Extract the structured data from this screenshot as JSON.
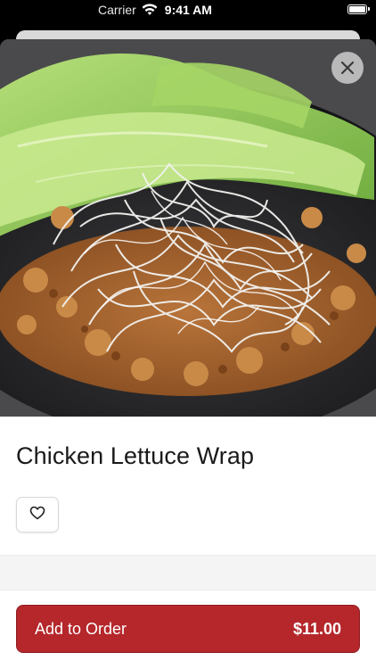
{
  "status_bar": {
    "carrier": "Carrier",
    "time": "9:41 AM",
    "wifi_icon": "wifi-icon",
    "battery_icon": "battery-icon"
  },
  "item": {
    "title": "Chicken Lettuce Wrap",
    "image_subject": "chicken lettuce wrap with crispy rice noodles",
    "close_icon": "close-icon",
    "favorite_icon": "heart-outline-icon"
  },
  "order": {
    "add_label": "Add to Order",
    "price": "$11.00",
    "accent_color": "#b5272b"
  }
}
